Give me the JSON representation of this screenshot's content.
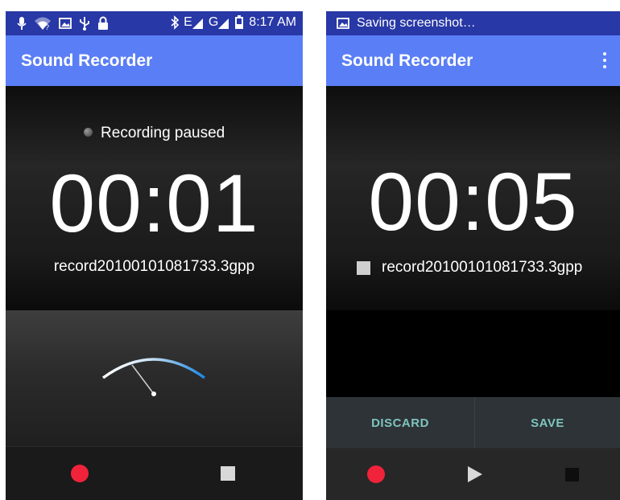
{
  "colors": {
    "status_bar": "#2838a6",
    "app_bar": "#5a7ef5",
    "record_red": "#f0233b",
    "action_text": "#7fc4c0"
  },
  "left": {
    "status_bar": {
      "left_icons": [
        "usb-mic-icon",
        "wifi-question-icon",
        "image-icon",
        "usb-icon",
        "lock-icon"
      ],
      "right_icons": [
        "bluetooth-icon",
        "signal-e-icon",
        "signal-g-icon",
        "battery-icon"
      ],
      "network_e": "E",
      "network_g": "G",
      "time": "8:17 AM"
    },
    "app_title": "Sound Recorder",
    "state_text": "Recording paused",
    "timer": "00:01",
    "filename": "record20100101081733.3gpp",
    "vu_level": 0.18,
    "controls": [
      "record",
      "stop"
    ]
  },
  "right": {
    "notification": "Saving screenshot…",
    "app_title": "Sound Recorder",
    "timer": "00:05",
    "filename": "record20100101081733.3gpp",
    "discard_label": "DISCARD",
    "save_label": "SAVE",
    "controls": [
      "record",
      "play",
      "stop"
    ]
  }
}
